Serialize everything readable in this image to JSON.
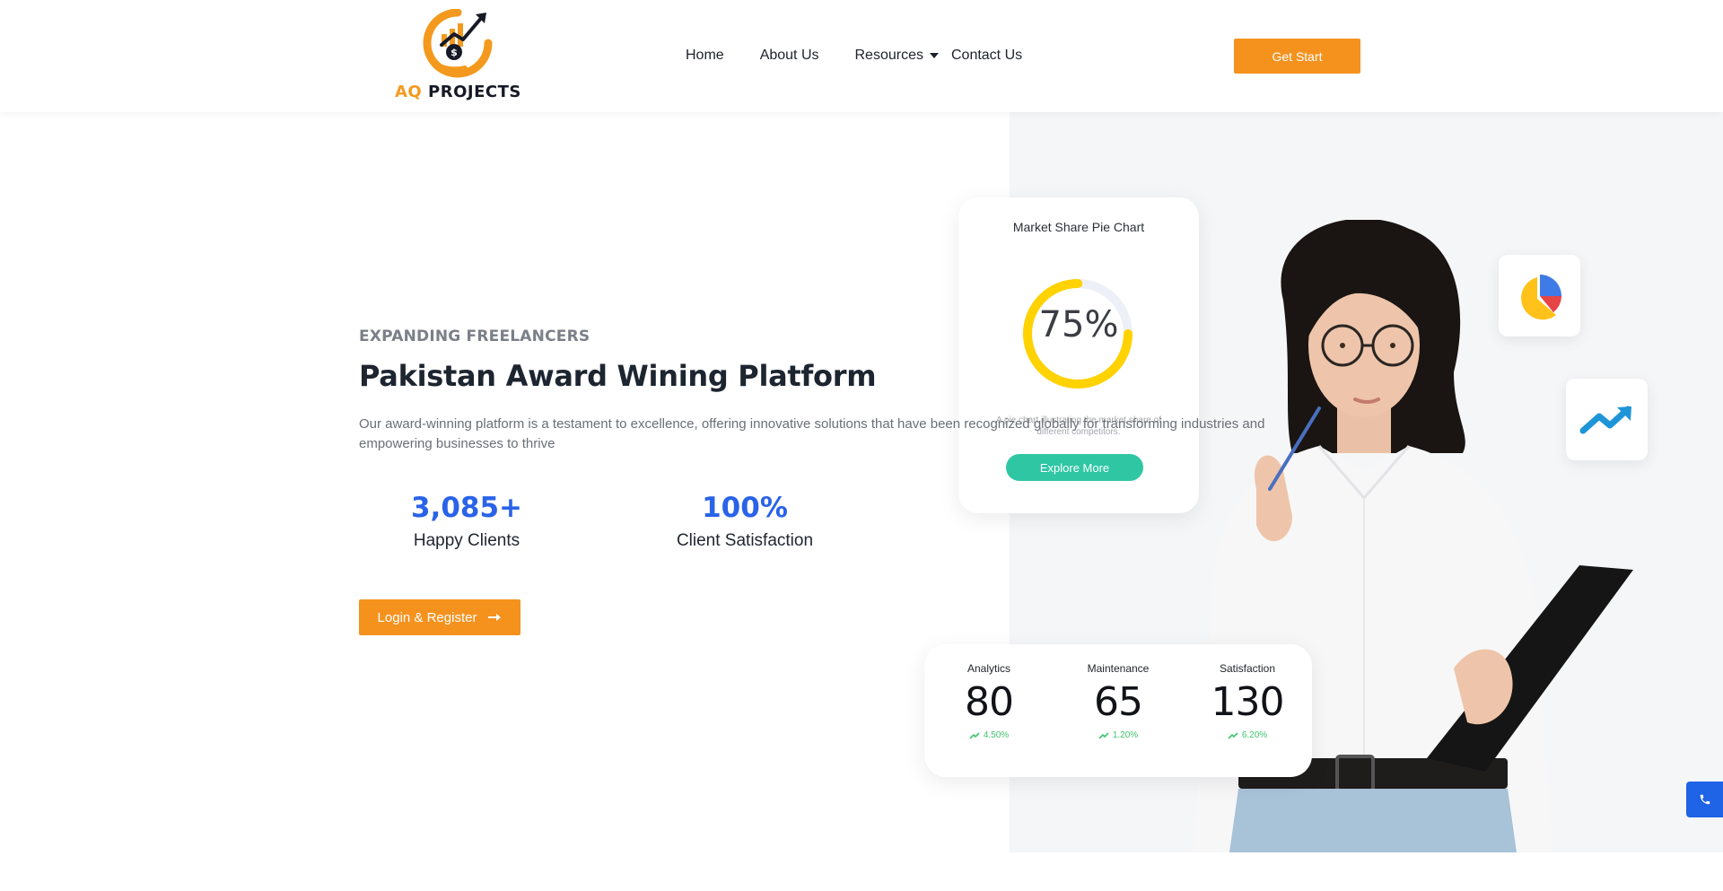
{
  "brand": {
    "logo_text_aq": "AQ",
    "logo_text_projects": "PROJECTS",
    "accent": "#f5921e",
    "dark": "#161a26"
  },
  "nav": {
    "items": [
      {
        "label": "Home",
        "has_dropdown": false
      },
      {
        "label": "About Us",
        "has_dropdown": false
      },
      {
        "label": "Resources",
        "has_dropdown": true
      },
      {
        "label": "Contact Us",
        "has_dropdown": false
      }
    ],
    "cta_label": "Get Start"
  },
  "hero": {
    "eyebrow": "EXPANDING FREELANCERS",
    "title": "Pakistan Award Wining Platform",
    "description": "Our award-winning platform is a testament to excellence, offering innovative solutions that have been recognized globally for transforming industries and empowering businesses to thrive",
    "stats": [
      {
        "value": "3,085+",
        "label": "Happy Clients"
      },
      {
        "value": "100%",
        "label": "Client Satisfaction"
      }
    ],
    "login_label": "Login & Register",
    "stat_color": "#2a63e8"
  },
  "pie_card": {
    "title": "Market Share Pie Chart",
    "percent_text": "75%",
    "percent_value": 0.75,
    "description": "A pie chart illustrating the market share of different competitors.",
    "button_label": "Explore More",
    "ring_color": "#ffd200",
    "button_color": "#2fc6a4"
  },
  "metrics": [
    {
      "label": "Analytics",
      "value": "80",
      "change": "4.50%"
    },
    {
      "label": "Maintenance",
      "value": "65",
      "change": "1.20%"
    },
    {
      "label": "Satisfaction",
      "value": "130",
      "change": "6.20%"
    }
  ],
  "icons": {
    "float_pie": "pie-chart-icon",
    "float_trend": "trending-up-icon",
    "phone": "phone-icon",
    "login_arrow": "arrow-right-icon"
  }
}
